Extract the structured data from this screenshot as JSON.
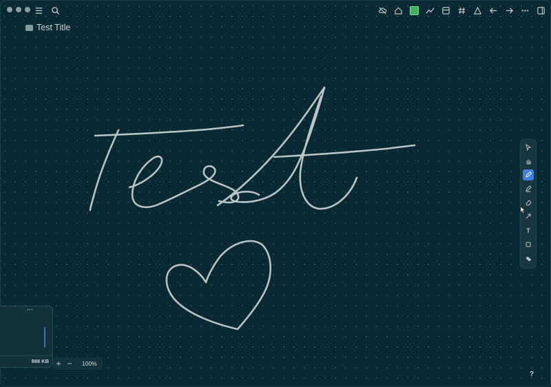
{
  "document": {
    "title": "Test Title"
  },
  "topbar": {
    "left_icons": [
      "menu-icon",
      "search-icon"
    ],
    "right_icons": [
      "cloud-off-icon",
      "home-icon",
      "green-square-icon",
      "graph-icon",
      "layout-icon",
      "hashtag-icon",
      "shapes-icon",
      "arrow-left-icon",
      "arrow-right-icon",
      "more-icon",
      "sidebar-icon"
    ]
  },
  "toolbar": {
    "tools": [
      {
        "name": "select-tool",
        "icon": "pointer-icon",
        "active": false
      },
      {
        "name": "hand-tool",
        "icon": "hand-icon",
        "active": false
      },
      {
        "name": "pen-tool",
        "icon": "pen-icon",
        "active": true
      },
      {
        "name": "highlighter-tool",
        "icon": "highlighter-icon",
        "active": false
      },
      {
        "name": "eraser-tool",
        "icon": "eraser-icon",
        "active": false
      },
      {
        "name": "arrow-tool",
        "icon": "arrow-icon",
        "active": false
      },
      {
        "name": "text-tool",
        "icon": "text-icon",
        "active": false
      },
      {
        "name": "shape-tool",
        "icon": "square-icon",
        "active": false
      },
      {
        "name": "image-tool",
        "icon": "image-icon",
        "active": false
      }
    ],
    "text_tool_label": "T"
  },
  "minimap": {
    "file_size": "888 KB",
    "dots": "•••"
  },
  "zoom": {
    "plus": "+",
    "minus": "−",
    "value": "100%"
  },
  "help": {
    "label": "?"
  },
  "colors": {
    "background": "#0a2a33",
    "stroke": "#b9c4c5",
    "accent": "#3e7fe0",
    "green": "#3fb25a"
  }
}
